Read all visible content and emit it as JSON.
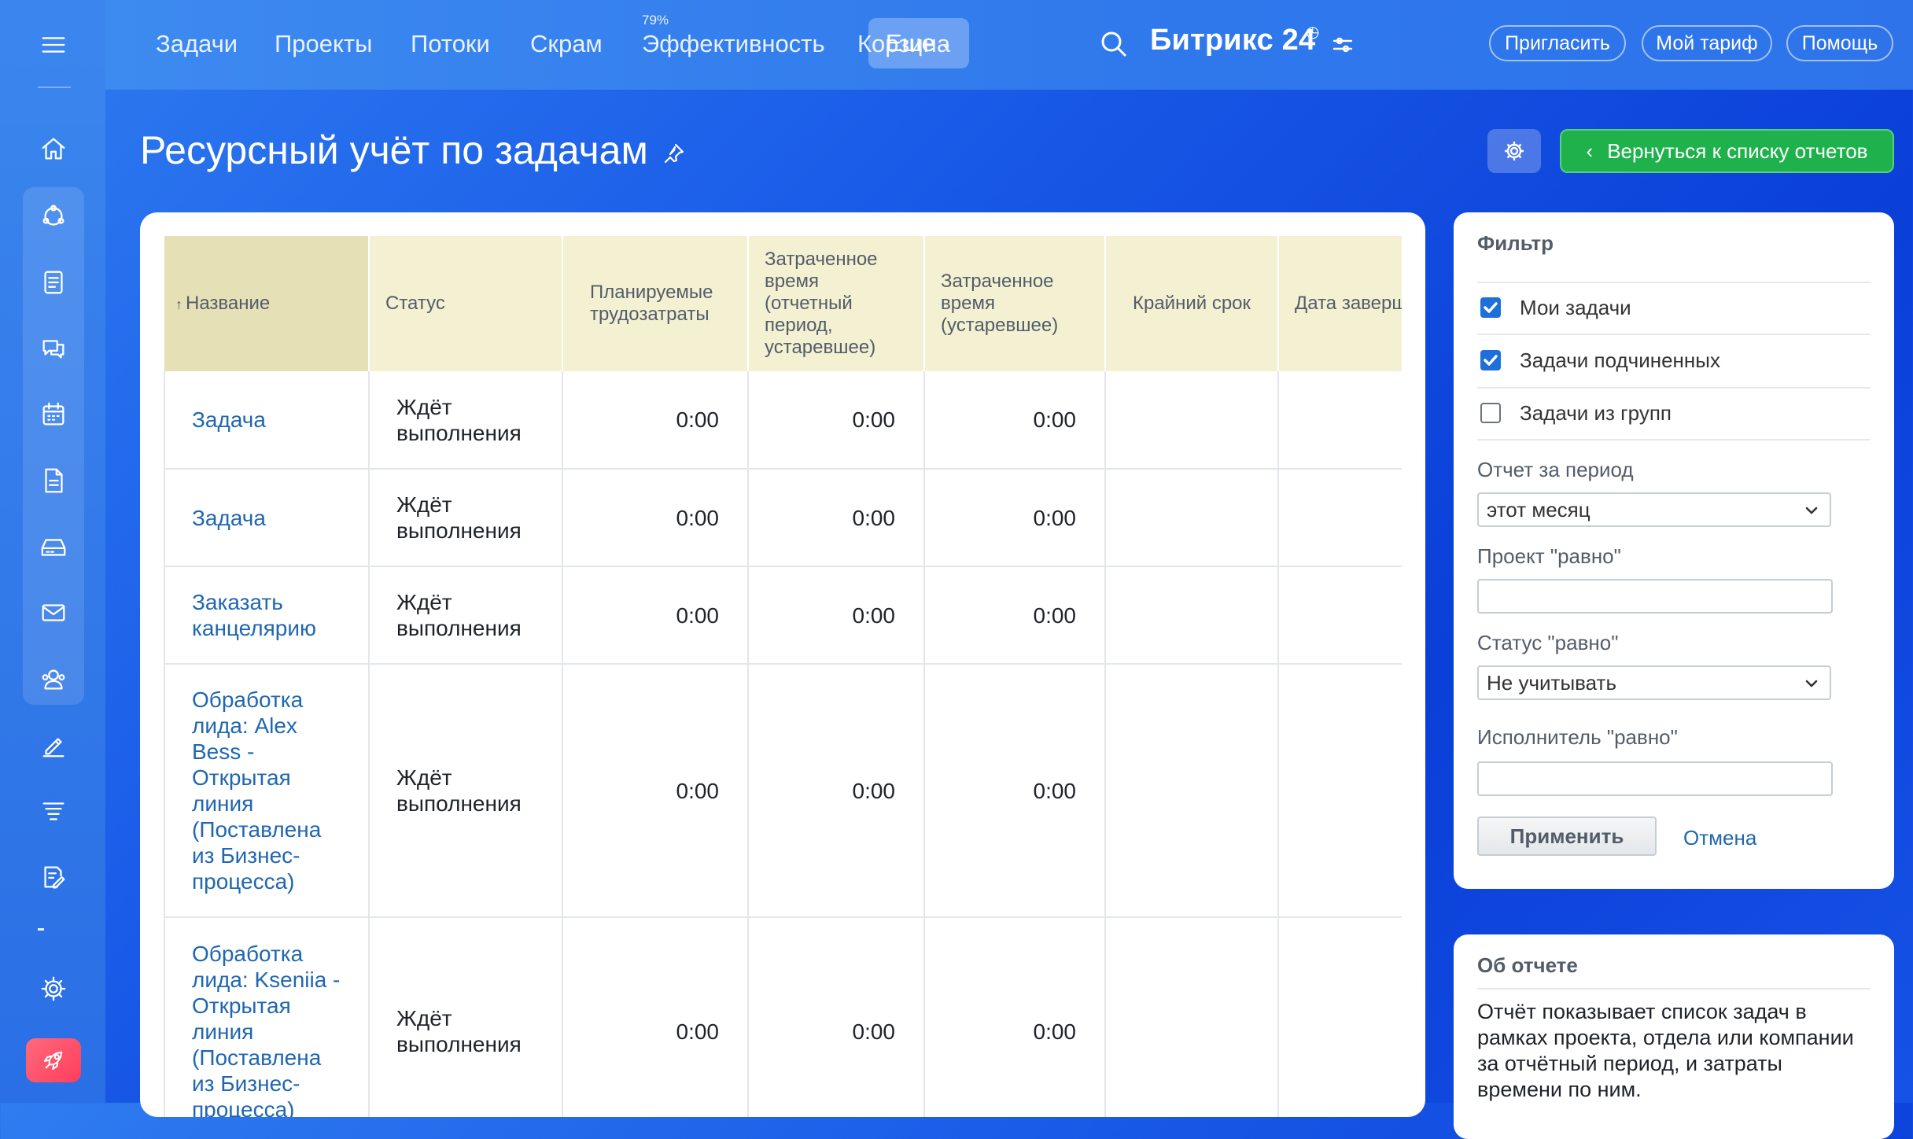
{
  "nav": {
    "items": [
      "Задачи",
      "Проекты",
      "Потоки",
      "Скрам",
      "Эффективность",
      "Корзина"
    ],
    "efficiency_badge": "79%",
    "more_label": "Еще",
    "brand": "Битрикс 24",
    "invite_label": "Пригласить",
    "tariff_label": "Мой тариф",
    "help_label": "Помощь"
  },
  "page": {
    "title": "Ресурсный учёт по задачам",
    "back_label": "Вернуться к списку отчетов"
  },
  "table": {
    "headers": {
      "name": "Название",
      "status": "Статус",
      "planned": "Планируемые трудозатраты",
      "spent_period": "Затраченное время (отчетный период, устаревшее)",
      "spent_old": "Затраченное время (устаревшее)",
      "deadline": "Крайний срок",
      "completed": "Дата завершения"
    },
    "rows": [
      {
        "name": "Задача",
        "status": "Ждёт выполнения",
        "planned": "0:00",
        "spent_period": "0:00",
        "spent_old": "0:00"
      },
      {
        "name": "Задача",
        "status": "Ждёт выполнения",
        "planned": "0:00",
        "spent_period": "0:00",
        "spent_old": "0:00"
      },
      {
        "name": "Заказать канцелярию",
        "status": "Ждёт выполнения",
        "planned": "0:00",
        "spent_period": "0:00",
        "spent_old": "0:00"
      },
      {
        "name": "Обработка лида: Alex Bess - Открытая линия (Поставлена из Бизнес-процесса)",
        "status": "Ждёт выполнения",
        "planned": "0:00",
        "spent_period": "0:00",
        "spent_old": "0:00"
      },
      {
        "name": "Обработка лида: Kseniia - Открытая линия (Поставлена из Бизнес-процесса)",
        "status": "Ждёт выполнения",
        "planned": "0:00",
        "spent_period": "0:00",
        "spent_old": "0:00"
      }
    ]
  },
  "filter": {
    "title": "Фильтр",
    "my_tasks": "Мои задачи",
    "sub_tasks": "Задачи подчиненных",
    "group_tasks": "Задачи из групп",
    "period_label": "Отчет за период",
    "period_value": "этот месяц",
    "project_label": "Проект \"равно\"",
    "status_label": "Статус \"равно\"",
    "status_value": "Не учитывать",
    "executor_label": "Исполнитель \"равно\"",
    "apply_label": "Применить",
    "cancel_label": "Отмена"
  },
  "about": {
    "title": "Об отчете",
    "text": "Отчёт показывает список задач в рамках проекта, отдела или компании за отчётный период, и затраты времени по ним."
  }
}
